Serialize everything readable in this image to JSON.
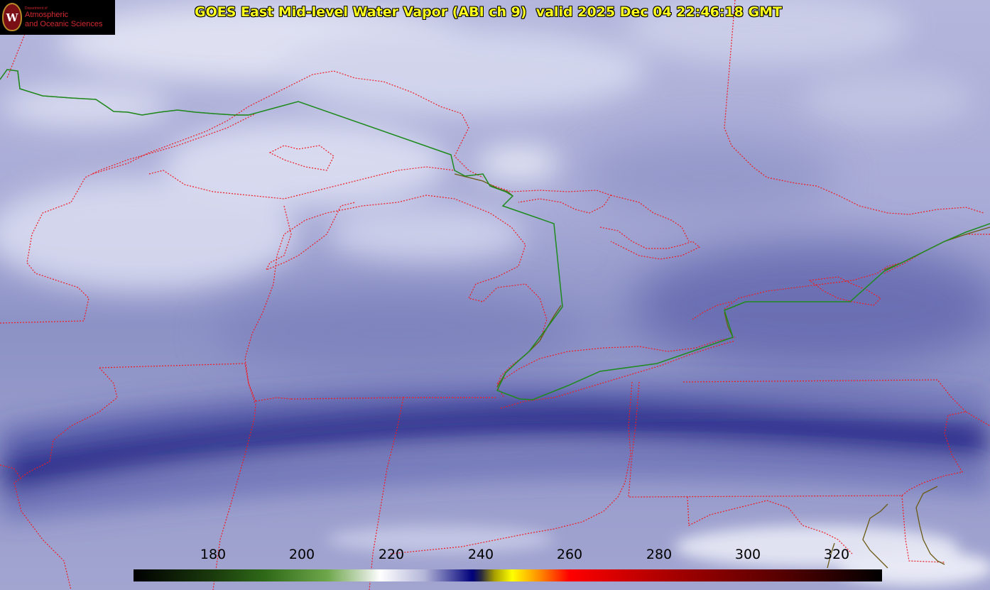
{
  "title": "GOES East Mid-level Water Vapor (ABI ch 9)  valid 2025 Dec 04 22:46:18 GMT",
  "logo": {
    "department": "Department of",
    "line1": "Atmospheric",
    "line2": "and Oceanic Sciences",
    "seal_letter": "W"
  },
  "colorbar": {
    "min": 170,
    "max": 340,
    "ticks": [
      "180",
      "200",
      "220",
      "240",
      "260",
      "280",
      "300",
      "320"
    ],
    "stops": [
      {
        "v": 170,
        "c": "#000000"
      },
      {
        "v": 188,
        "c": "#1a3a0c"
      },
      {
        "v": 200,
        "c": "#2f6a18"
      },
      {
        "v": 214,
        "c": "#6ea64a"
      },
      {
        "v": 222,
        "c": "#c9dcc0"
      },
      {
        "v": 226,
        "c": "#ffffff"
      },
      {
        "v": 236,
        "c": "#b4b6d8"
      },
      {
        "v": 247,
        "c": "#00007a"
      },
      {
        "v": 249,
        "c": "#2a2a40"
      },
      {
        "v": 252,
        "c": "#a8a000"
      },
      {
        "v": 256,
        "c": "#ffff00"
      },
      {
        "v": 262,
        "c": "#ff9000"
      },
      {
        "v": 269,
        "c": "#ff0000"
      },
      {
        "v": 292,
        "c": "#a80000"
      },
      {
        "v": 316,
        "c": "#5a0000"
      },
      {
        "v": 340,
        "c": "#000000"
      }
    ]
  },
  "colors": {
    "state_borders": "#ee1c24",
    "international_border": "#1e8a1e",
    "coast_canada": "#6b5a14",
    "moisture_band": "#04046e",
    "dry_haze": "#a4a8d2"
  }
}
